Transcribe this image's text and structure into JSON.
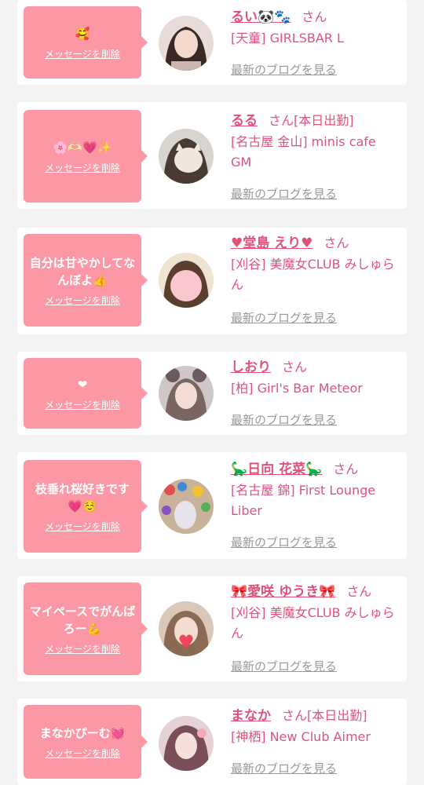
{
  "delete_label": "メッセージを削除",
  "blog_label": "最新のブログを見る",
  "san_label": "さん",
  "accent_color": "#fc97a5",
  "text_color": "#e0527a",
  "cards": [
    {
      "message": "🥰",
      "name": "るい🐼🐾",
      "status": "",
      "shop": "[天童] GIRLSBAR L",
      "avatar": "avatar-photo"
    },
    {
      "message": "🌸🫶🏻💗✨",
      "name": "るる",
      "status": "[本日出勤]",
      "shop": "[名古屋 金山] minis cafe GM",
      "avatar": "avatar-photo"
    },
    {
      "message": "自分は甘やかしてなんぼよ👍",
      "name": "♥堂島 えり♥",
      "status": "",
      "shop": "[刈谷] 美魔女CLUB みしゅらん",
      "avatar": "avatar-photo"
    },
    {
      "message": "❤",
      "name": "しおり",
      "status": "",
      "shop": "[柏] Girl's Bar Meteor",
      "avatar": "avatar-photo"
    },
    {
      "message": "枝垂れ桜好きです💗☺️",
      "name": "🦕日向 花菜🦕",
      "status": "",
      "shop": "[名古屋 錦] First Lounge Liber",
      "avatar": "avatar-photo"
    },
    {
      "message": "マイペースでがんばろー💪",
      "name": "🎀愛咲 ゆうき🎀",
      "status": "",
      "shop": "[刈谷] 美魔女CLUB みしゅらん",
      "avatar": "avatar-photo"
    },
    {
      "message": "まなかぴーむ💓",
      "name": "まなか",
      "status": "[本日出勤]",
      "shop": "[神栖] New Club Aimer",
      "avatar": "avatar-photo"
    }
  ]
}
